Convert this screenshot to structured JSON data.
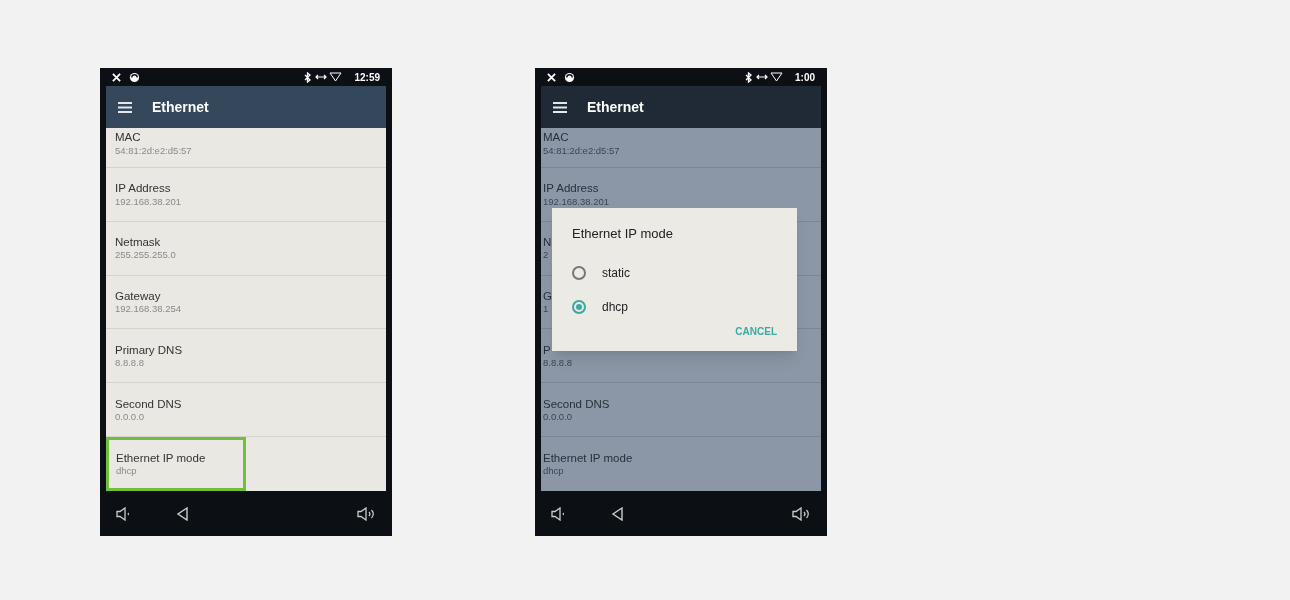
{
  "screens": [
    {
      "time": "12:59",
      "title": "Ethernet",
      "rows": [
        {
          "label": "MAC",
          "value": "54:81:2d:e2:d5:57",
          "highlighted": false
        },
        {
          "label": "IP Address",
          "value": "192.168.38.201",
          "highlighted": false
        },
        {
          "label": "Netmask",
          "value": "255.255.255.0",
          "highlighted": false
        },
        {
          "label": "Gateway",
          "value": "192.168.38.254",
          "highlighted": false
        },
        {
          "label": "Primary DNS",
          "value": "8.8.8.8",
          "highlighted": false
        },
        {
          "label": "Second DNS",
          "value": "0.0.0.0",
          "highlighted": false
        },
        {
          "label": "Ethernet IP mode",
          "value": "dhcp",
          "highlighted": true
        }
      ]
    },
    {
      "time": "1:00",
      "title": "Ethernet",
      "rows": [
        {
          "label": "MAC",
          "value": "54:81:2d:e2:d5:57",
          "highlighted": false
        },
        {
          "label": "IP Address",
          "value": "192.168.38.201",
          "highlighted": false
        },
        {
          "label": "N",
          "value": "2",
          "highlighted": false
        },
        {
          "label": "G",
          "value": "1",
          "highlighted": false
        },
        {
          "label": "P",
          "value": "8.8.8.8",
          "highlighted": false
        },
        {
          "label": "Second DNS",
          "value": "0.0.0.0",
          "highlighted": false
        },
        {
          "label": "Ethernet IP mode",
          "value": "dhcp",
          "highlighted": false
        }
      ],
      "dialog": {
        "title": "Ethernet IP mode",
        "options": [
          {
            "label": "static",
            "selected": false
          },
          {
            "label": "dhcp",
            "selected": true
          }
        ],
        "button": "CANCEL"
      }
    }
  ]
}
